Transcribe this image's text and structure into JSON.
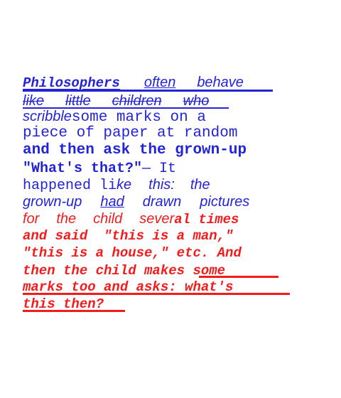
{
  "colors": {
    "blue": "#2323d8",
    "red": "#f31c1c"
  },
  "text": {
    "l1_a": "Philosophers",
    "l1_b": "often",
    "l1_c": "behave",
    "l2_a": "like",
    "l2_b": "little",
    "l2_c": "children",
    "l2_d": "who",
    "l3_a": "scribble",
    "l3_b": " some marks on a",
    "l4": "piece of paper at random",
    "l5": "and then ask the grown-up",
    "l6_a": "\"What's that?\"",
    "l6_b": " — It",
    "l7_a": "happened li",
    "l7_b": "ke",
    "l7_c": "this:",
    "l7_d": "the",
    "l8_a": "grown-up",
    "l8_b": "had",
    "l8_c": "drawn",
    "l8_d": "pictures",
    "l9_a": "for",
    "l9_b": "the",
    "l9_c": "child",
    "l9_d": "sever",
    "l9_e": "al times",
    "l10": "and said  \"this is a man,\"",
    "l11": "\"this is a house,\" etc. And",
    "l12_a": "then the child ma",
    "l12_b": "kes some",
    "l13": "marks too and asks: what's",
    "l14": "this then?"
  }
}
